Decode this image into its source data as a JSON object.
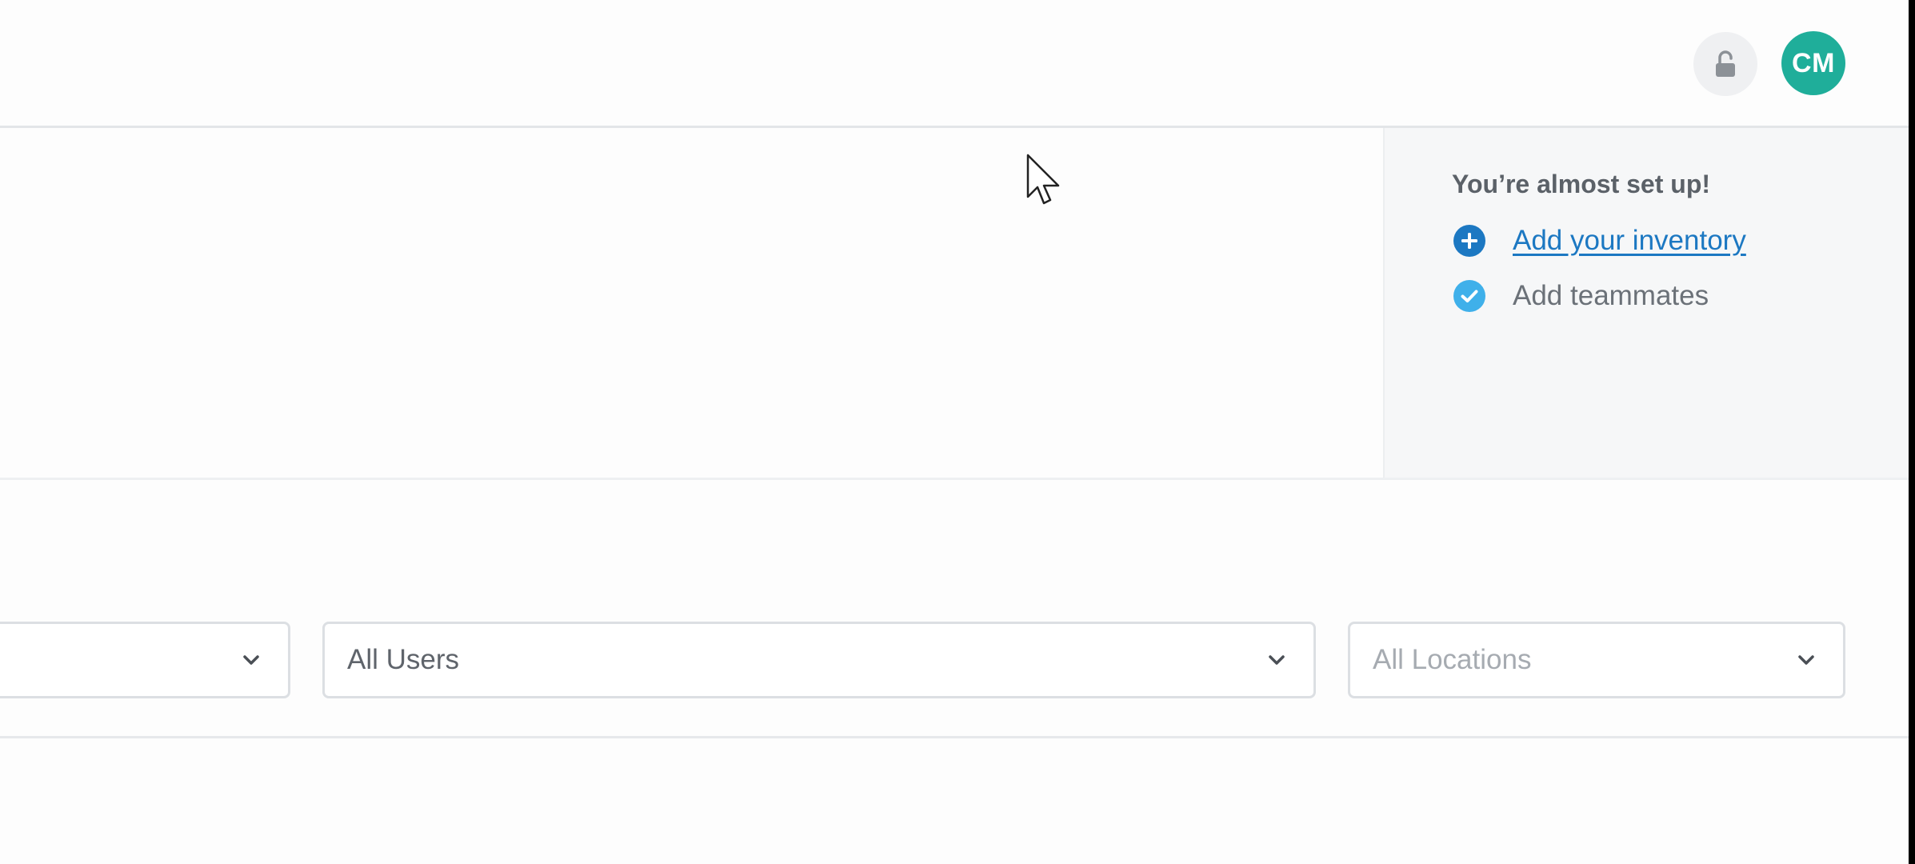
{
  "header": {
    "lock_icon": "unlocked-padlock-icon",
    "avatar": {
      "initials": "CM",
      "color": "#1fae9a"
    }
  },
  "setup": {
    "title": "You’re almost set up!",
    "items": [
      {
        "label": "Add your inventory",
        "icon": "plus-circle-icon",
        "icon_color": "#1c78c2",
        "state": "todo"
      },
      {
        "label": "Add teammates",
        "icon": "check-circle-icon",
        "icon_color": "#3fb0ea",
        "state": "done"
      }
    ]
  },
  "filters": {
    "first": {
      "value": ""
    },
    "users": {
      "value": "All Users"
    },
    "locations": {
      "placeholder": "All Locations"
    }
  },
  "colors": {
    "accent": "#1c78c2",
    "avatar": "#1fae9a",
    "check": "#3fb0ea"
  }
}
